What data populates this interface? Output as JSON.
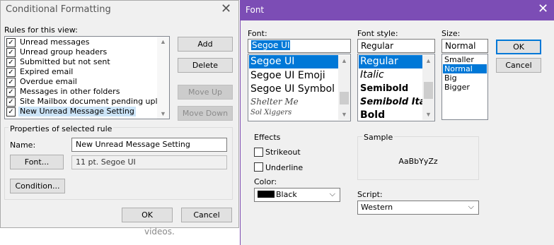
{
  "cf_dialog": {
    "title": "Conditional Formatting",
    "rules_label": "Rules for this view:",
    "rules": [
      {
        "label": "Unread messages",
        "checked": true
      },
      {
        "label": "Unread group headers",
        "checked": true
      },
      {
        "label": "Submitted but not sent",
        "checked": true
      },
      {
        "label": "Expired email",
        "checked": true
      },
      {
        "label": "Overdue email",
        "checked": true
      },
      {
        "label": "Messages in other folders",
        "checked": true
      },
      {
        "label": "Site Mailbox document pending uploa",
        "checked": true
      },
      {
        "label": "New Unread Message Setting",
        "checked": true
      }
    ],
    "buttons": {
      "add": "Add",
      "delete": "Delete",
      "move_up": "Move Up",
      "move_down": "Move Down",
      "ok": "OK",
      "cancel": "Cancel"
    },
    "properties_label": "Properties of selected rule",
    "name_label": "Name:",
    "name_value": "New Unread Message Setting",
    "font_button": "Font...",
    "font_value": "11 pt. Segoe UI",
    "condition_button": "Condition...",
    "check_glyph": "✓"
  },
  "background_text": "videos.",
  "font_dialog": {
    "title": "Font",
    "font_label": "Font:",
    "font_value": "Segoe UI",
    "fonts": [
      "Segoe UI",
      "Segoe UI Emoji",
      "Segoe UI Symbol",
      "Shelter Me",
      "Sol Xiggers"
    ],
    "style_label": "Font style:",
    "style_value": "Regular",
    "styles": [
      "Regular",
      "Italic",
      "Semibold",
      "Semibold Italic",
      "Bold"
    ],
    "size_label": "Size:",
    "size_value": "Normal",
    "sizes": [
      "Smaller",
      "Normal",
      "Big",
      "Bigger"
    ],
    "ok": "OK",
    "cancel": "Cancel",
    "effects_label": "Effects",
    "strikeout": "Strikeout",
    "underline": "Underline",
    "color_label": "Color:",
    "color_value": "Black",
    "color_swatch": "#000000",
    "sample_label": "Sample",
    "sample_text": "AaBbYyZz",
    "script_label": "Script:",
    "script_value": "Western",
    "dropdown_glyph": "⌵"
  },
  "colors": {
    "title_bar": "#7c4db5",
    "selection": "#0078d7",
    "rule_selection": "#cce4f7"
  }
}
